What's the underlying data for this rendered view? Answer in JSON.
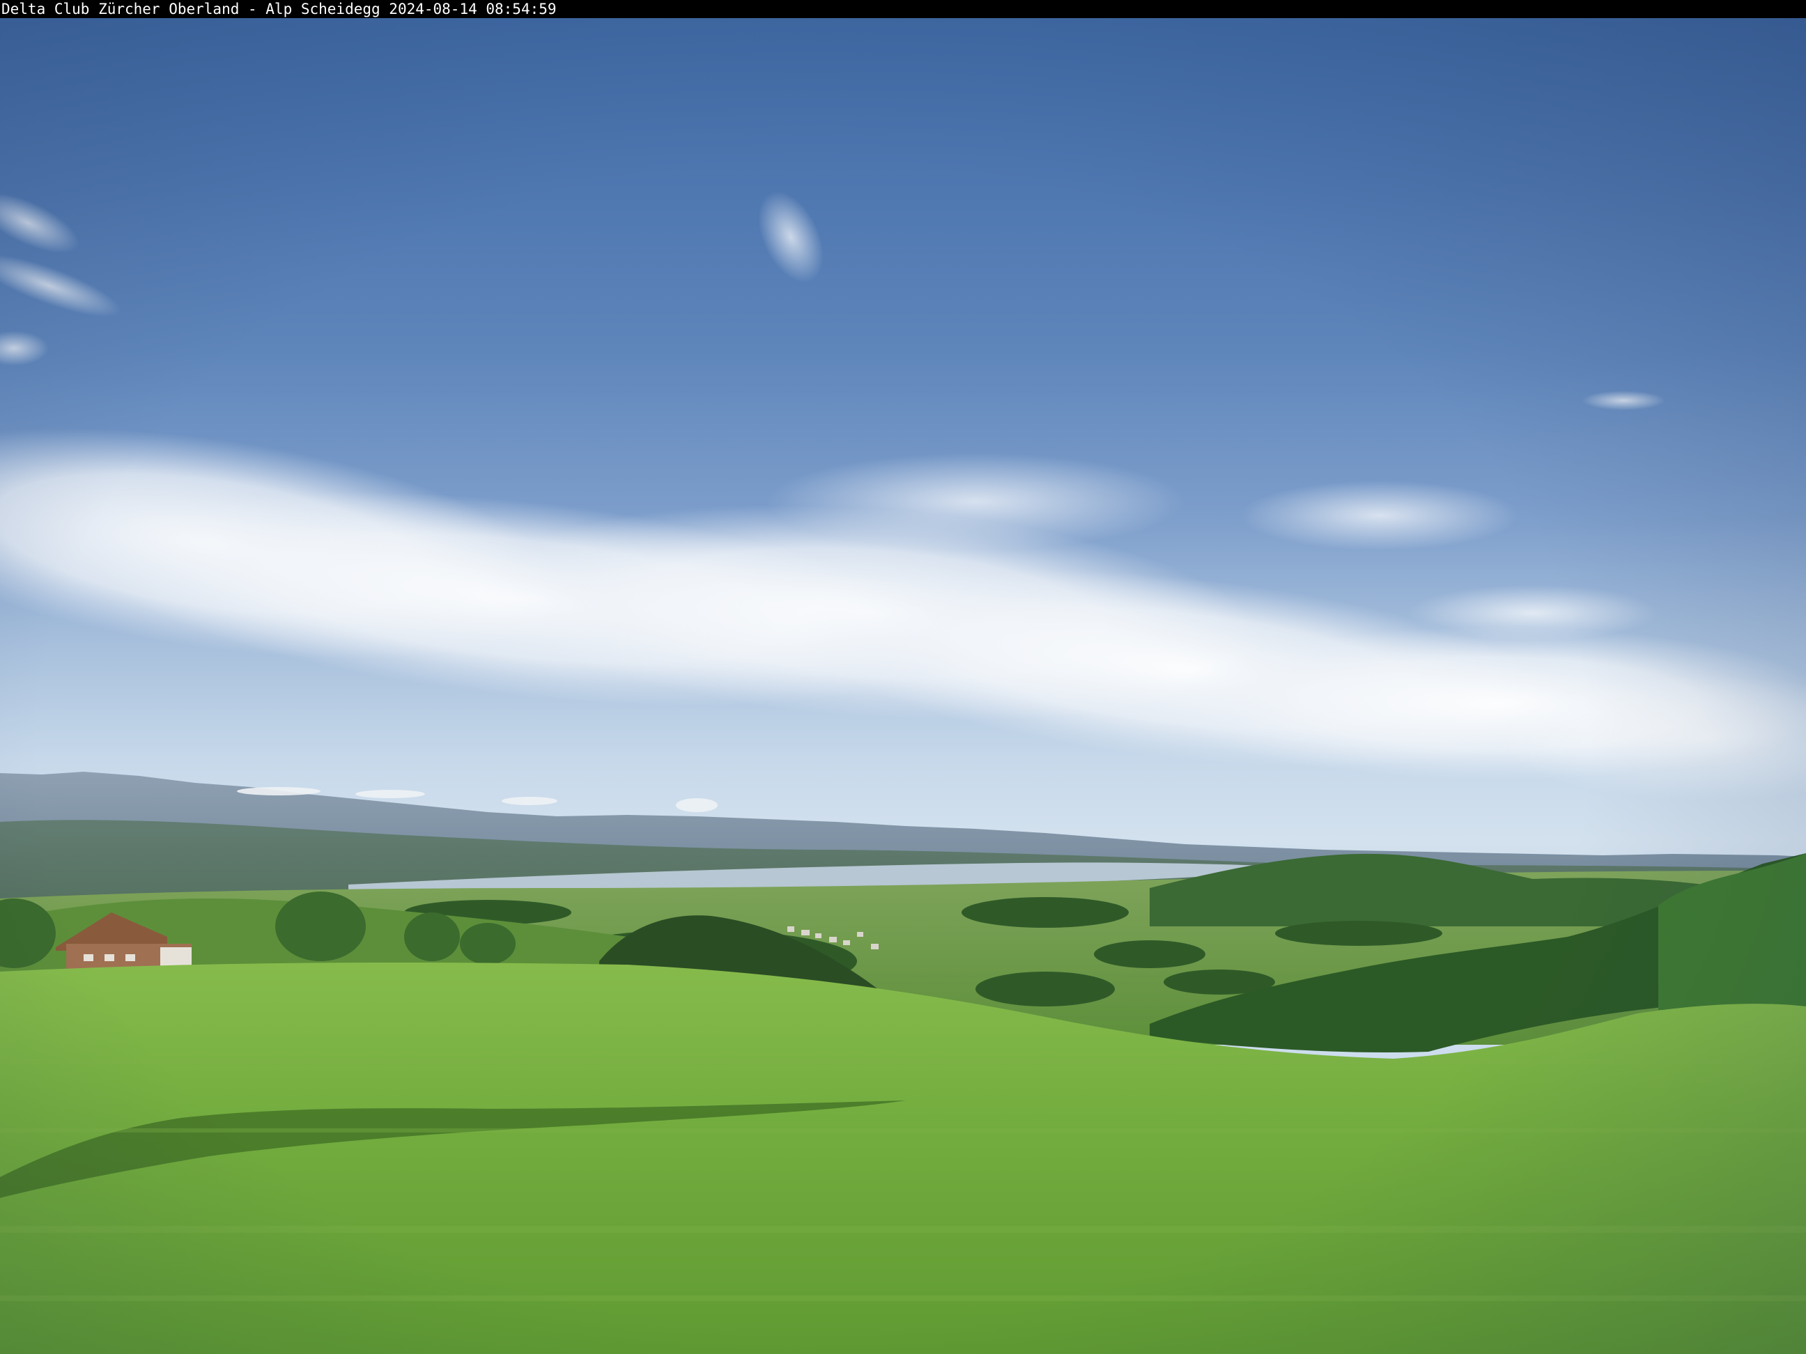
{
  "overlay": {
    "caption": "Delta Club Zürcher Oberland - Alp Scheidegg 2024-08-14 08:54:59",
    "caption_color": "#ffffff",
    "bar_color": "#000000"
  },
  "scene": {
    "sky_color": "#4f77b0",
    "cloud_color": "#eef2f6",
    "meadow_color": "#6faa3c",
    "forest_color": "#2f5a28",
    "mountain_color": "#7f95a8",
    "lake_color": "#b9c9d6"
  }
}
